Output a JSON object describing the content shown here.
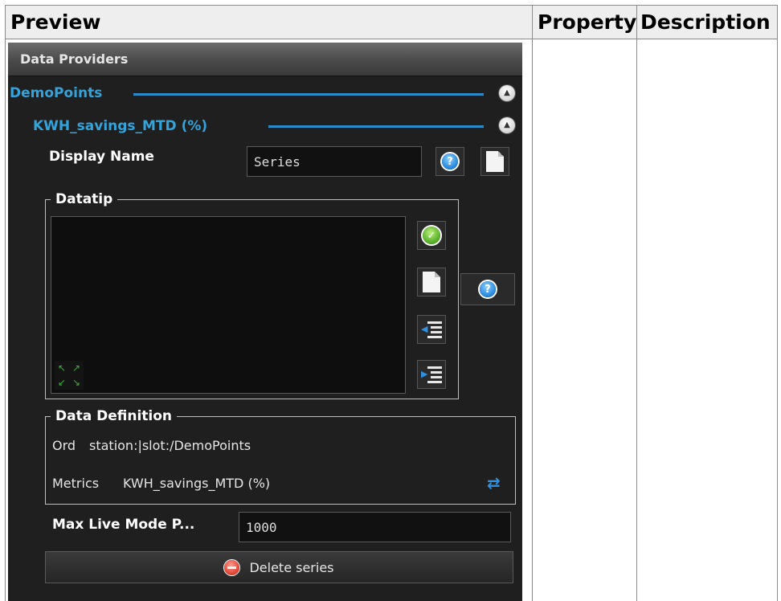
{
  "doc_table": {
    "headers": {
      "preview": "Preview",
      "property": "Property",
      "description": "Description"
    }
  },
  "panel": {
    "title": "Data Providers",
    "provider": {
      "name": "DemoPoints",
      "collapse_icon": "collapse-up-icon"
    },
    "series": {
      "name": "KWH_savings_MTD (%)",
      "display_name": {
        "label": "Display Name",
        "value": "Series"
      },
      "datatip": {
        "legend": "Datatip",
        "value": ""
      },
      "data_definition": {
        "legend": "Data Definition",
        "ord_label": "Ord",
        "ord_value": "station:|slot:/DemoPoints",
        "metrics_label": "Metrics",
        "metrics_value": "KWH_savings_MTD (%)"
      },
      "max_live": {
        "label": "Max Live Mode P...",
        "value": "1000"
      },
      "delete_label": "Delete series"
    }
  },
  "colors": {
    "accent_blue": "#33a3dc",
    "panel_bg": "#1f1f1f",
    "header_bg": "#4a4a4a"
  },
  "icons": {
    "help": "help-icon",
    "new_document": "new-document-icon",
    "check": "check-icon",
    "expand": "expand-icon",
    "indent": "indent-icon",
    "outdent": "outdent-icon",
    "swap": "swap-icon",
    "remove": "remove-icon"
  }
}
